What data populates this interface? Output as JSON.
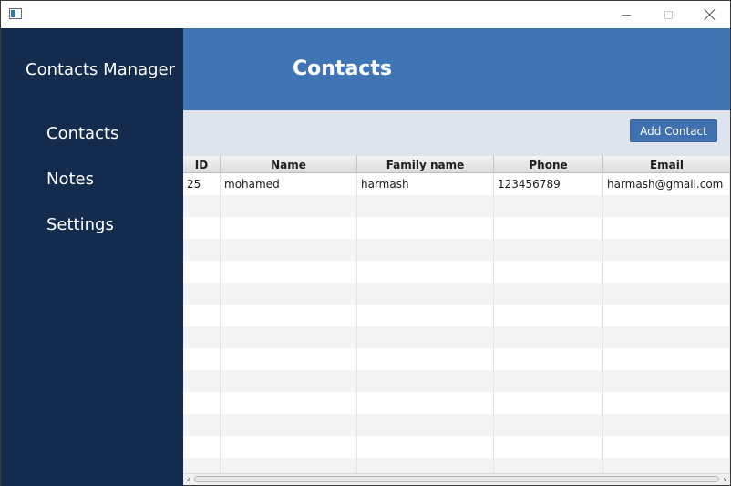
{
  "window": {
    "icon": "app-window-icon",
    "controls": [
      "minimize-icon",
      "maximize-icon",
      "close-icon"
    ]
  },
  "sidebar": {
    "title": "Contacts Manager",
    "items": [
      {
        "label": "Contacts"
      },
      {
        "label": "Notes"
      },
      {
        "label": "Settings"
      }
    ]
  },
  "header": {
    "title": "Contacts"
  },
  "toolbar": {
    "add_label": "Add Contact"
  },
  "table": {
    "columns": [
      "ID",
      "Name",
      "Family name",
      "Phone",
      "Email"
    ],
    "rows": [
      [
        "25",
        "mohamed",
        "harmash",
        "123456789",
        "harmash@gmail.com"
      ]
    ]
  },
  "colors": {
    "sidebar_bg": "#132c4e",
    "header_bg": "#4075b4",
    "toolbar_bg": "#dee3ee",
    "button_bg": "#4070b0"
  }
}
